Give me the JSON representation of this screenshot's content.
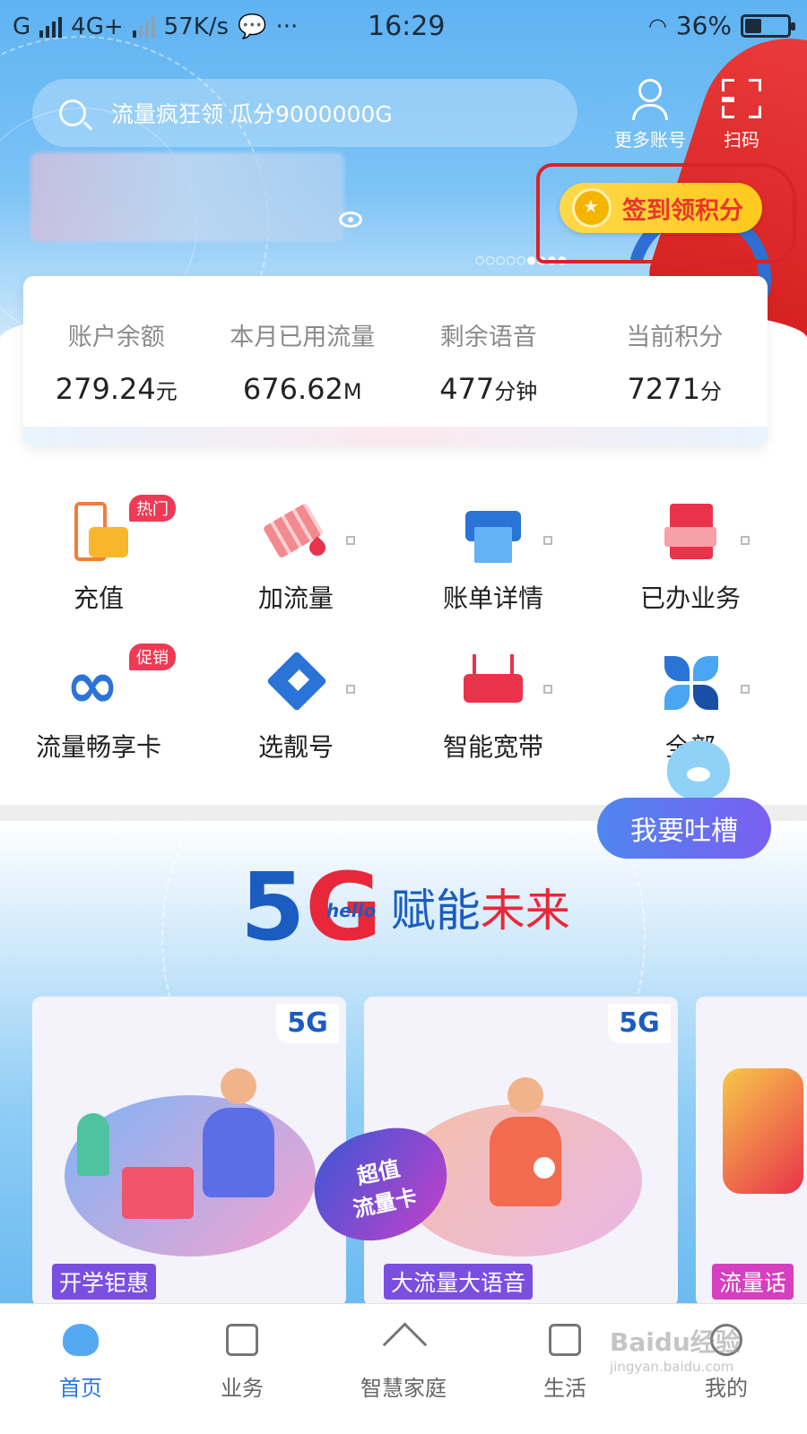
{
  "status_bar": {
    "carrier": "G",
    "network": "4G+",
    "speed": "57K/s",
    "more": "···",
    "time": "16:29",
    "battery": "36%"
  },
  "header": {
    "search_placeholder": "流量疯狂领 瓜分9000000G",
    "more_accounts": "更多账号",
    "scan": "扫码",
    "signin": "签到领积分"
  },
  "stats": [
    {
      "label": "账户余额",
      "value": "279.24",
      "unit": "元"
    },
    {
      "label": "本月已用流量",
      "value": "676.62",
      "unit": "M"
    },
    {
      "label": "剩余语音",
      "value": "477",
      "unit": "分钟"
    },
    {
      "label": "当前积分",
      "value": "7271",
      "unit": "分"
    }
  ],
  "services": [
    {
      "label": "充值",
      "badge": "热门"
    },
    {
      "label": "加流量"
    },
    {
      "label": "账单详情"
    },
    {
      "label": "已办业务"
    },
    {
      "label": "流量畅享卡",
      "badge": "促销"
    },
    {
      "label": "选靓号"
    },
    {
      "label": "智能宽带"
    },
    {
      "label": "全部"
    }
  ],
  "complain": "我要吐槽",
  "banner": {
    "logo_main": "5",
    "logo_g": "G",
    "logo_hello": "hello",
    "slogan_part1": "赋能",
    "slogan_part2": "未来",
    "badge_line1": "超值",
    "badge_line2": "流量卡",
    "cards": [
      {
        "tag": "开学钜惠",
        "logo": "5G"
      },
      {
        "tag": "大流量大语音",
        "logo": "5G"
      },
      {
        "tag": "流量话"
      }
    ]
  },
  "bottom_nav": [
    {
      "label": "首页"
    },
    {
      "label": "业务"
    },
    {
      "label": "智慧家庭"
    },
    {
      "label": "生活"
    },
    {
      "label": "我的"
    }
  ],
  "watermark": {
    "main": "Baidu经验",
    "sub": "jingyan.baidu.com"
  },
  "colors": {
    "primary_blue": "#2a7ae2",
    "header_blue": "#6bbaf1",
    "accent_red": "#e8283a",
    "signin_yellow": "#ffd84b"
  }
}
